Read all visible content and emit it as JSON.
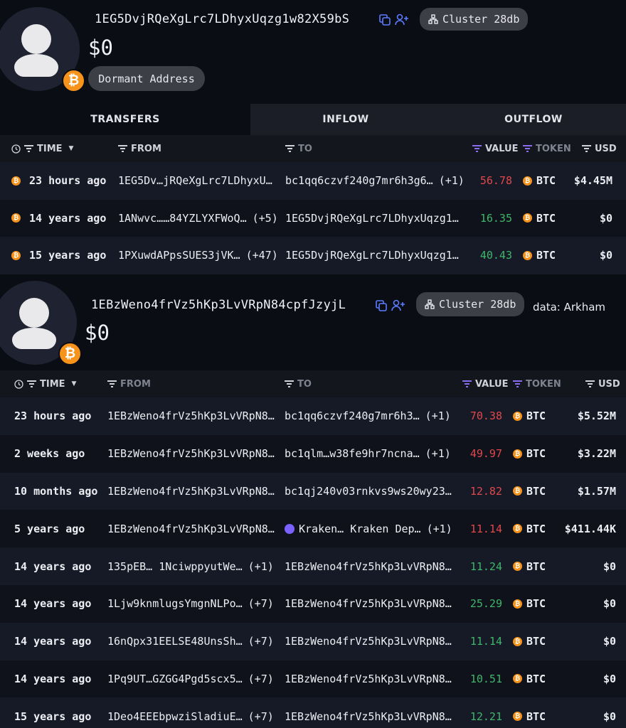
{
  "profile1": {
    "address": "1EG5DvjRQeXgLrc7LDhyxUqzg1w82X59bS",
    "balance": "$0",
    "cluster_label": "Cluster 28db",
    "status_badge": "Dormant Address",
    "icon": "bitcoin-icon"
  },
  "tabs": [
    {
      "label": "TRANSFERS",
      "active": true
    },
    {
      "label": "INFLOW",
      "active": false
    },
    {
      "label": "OUTFLOW",
      "active": false
    }
  ],
  "table1": {
    "headers": {
      "time": "TIME",
      "from": "FROM",
      "to": "TO",
      "value": "VALUE",
      "token": "TOKEN",
      "usd": "USD"
    },
    "rows": [
      {
        "time": "23 hours ago",
        "from": "1EG5Dv…jRQeXgLrc7LDhyxU…",
        "from_extra": "",
        "to": "bc1qq6czvf240g7mr6h3g6…",
        "to_extra": "(+1)",
        "value": "56.78",
        "direction": "out",
        "token": "BTC",
        "usd": "$4.45M"
      },
      {
        "time": "14 years ago",
        "from": "1ANwvc……84YZLYXFWoQ…",
        "from_extra": "(+5)",
        "to": "1EG5DvjRQeXgLrc7LDhyxUqzg1…",
        "to_extra": "",
        "value": "16.35",
        "direction": "in",
        "token": "BTC",
        "usd": "$0"
      },
      {
        "time": "15 years ago",
        "from": "1PXuwdAPpsSUES3jVK…",
        "from_extra": "(+47)",
        "to": "1EG5DvjRQeXgLrc7LDhyxUqzg1…",
        "to_extra": "",
        "value": "40.43",
        "direction": "in",
        "token": "BTC",
        "usd": "$0"
      }
    ]
  },
  "profile2": {
    "address": "1EBzWeno4frVz5hKp3LvVRpN84cpfJzyjL",
    "balance": "$0",
    "cluster_label": "Cluster 28db",
    "icon": "bitcoin-icon"
  },
  "credit": "data: Arkham",
  "table2": {
    "headers": {
      "time": "TIME",
      "from": "FROM",
      "to": "TO",
      "value": "VALUE",
      "token": "TOKEN",
      "usd": "USD"
    },
    "rows": [
      {
        "time": "23 hours ago",
        "from": "1EBzWeno4frVz5hKp3LvVRpN8…",
        "from_extra": "",
        "to": "bc1qq6czvf240g7mr6h3…",
        "to_extra": "(+1)",
        "value": "70.38",
        "direction": "out",
        "token": "BTC",
        "usd": "$5.52M"
      },
      {
        "time": "2 weeks ago",
        "from": "1EBzWeno4frVz5hKp3LvVRpN8…",
        "from_extra": "",
        "to": "bc1qlm…w38fe9hr7ncna…",
        "to_extra": "(+1)",
        "value": "49.97",
        "direction": "out",
        "token": "BTC",
        "usd": "$3.22M"
      },
      {
        "time": "10 months ago",
        "from": "1EBzWeno4frVz5hKp3LvVRpN8…",
        "from_extra": "",
        "to": "bc1qj240v03rnkvs9ws20wy23…",
        "to_extra": "",
        "value": "12.82",
        "direction": "out",
        "token": "BTC",
        "usd": "$1.57M"
      },
      {
        "time": "5 years ago",
        "from": "1EBzWeno4frVz5hKp3LvVRpN8…",
        "from_extra": "",
        "to": "Kraken… Kraken Dep…",
        "to_extra": "(+1)",
        "to_entity": "kraken",
        "value": "11.14",
        "direction": "out",
        "token": "BTC",
        "usd": "$411.44K"
      },
      {
        "time": "14 years ago",
        "from": "135pEB… 1NciwppyutWe…",
        "from_extra": "(+1)",
        "to": "1EBzWeno4frVz5hKp3LvVRpN8…",
        "to_extra": "",
        "value": "11.24",
        "direction": "in",
        "token": "BTC",
        "usd": "$0"
      },
      {
        "time": "14 years ago",
        "from": "1Ljw9knmlugsYmgnNLPo…",
        "from_extra": "(+7)",
        "to": "1EBzWeno4frVz5hKp3LvVRpN8…",
        "to_extra": "",
        "value": "25.29",
        "direction": "in",
        "token": "BTC",
        "usd": "$0"
      },
      {
        "time": "14 years ago",
        "from": "16nQpx31EELSE48UnsSh…",
        "from_extra": "(+7)",
        "to": "1EBzWeno4frVz5hKp3LvVRpN8…",
        "to_extra": "",
        "value": "11.14",
        "direction": "in",
        "token": "BTC",
        "usd": "$0"
      },
      {
        "time": "14 years ago",
        "from": "1Pq9UT…GZGG4Pgd5scx5…",
        "from_extra": "(+7)",
        "to": "1EBzWeno4frVz5hKp3LvVRpN8…",
        "to_extra": "",
        "value": "10.51",
        "direction": "in",
        "token": "BTC",
        "usd": "$0"
      },
      {
        "time": "15 years ago",
        "from": "1Deo4EEEbpwziSladiuE…",
        "from_extra": "(+7)",
        "to": "1EBzWeno4frVz5hKp3LvVRpN8…",
        "to_extra": "",
        "value": "12.21",
        "direction": "in",
        "token": "BTC",
        "usd": "$0"
      }
    ]
  },
  "colors": {
    "in": "#3fb76a",
    "out": "#e0484c",
    "bitcoin": "#f7931a",
    "accent": "#5b7cff"
  }
}
